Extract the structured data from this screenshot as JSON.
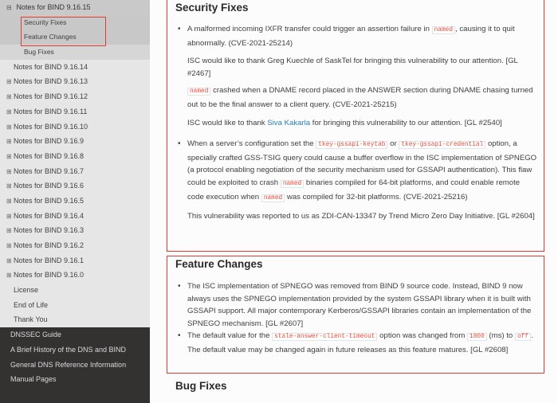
{
  "sidebar": {
    "current": {
      "toggle": "⊟",
      "label": "Notes for BIND 9.16.15"
    },
    "sub_items": [
      "Security Fixes",
      "Feature Changes",
      "Bug Fixes"
    ],
    "versions": [
      {
        "label": "Notes for BIND 9.16.14",
        "expandable": false
      },
      {
        "label": "Notes for BIND 9.16.13",
        "expandable": true
      },
      {
        "label": "Notes for BIND 9.16.12",
        "expandable": true
      },
      {
        "label": "Notes for BIND 9.16.11",
        "expandable": true
      },
      {
        "label": "Notes for BIND 9.16.10",
        "expandable": true
      },
      {
        "label": "Notes for BIND 9.16.9",
        "expandable": true
      },
      {
        "label": "Notes for BIND 9.16.8",
        "expandable": true
      },
      {
        "label": "Notes for BIND 9.16.7",
        "expandable": true
      },
      {
        "label": "Notes for BIND 9.16.6",
        "expandable": true
      },
      {
        "label": "Notes for BIND 9.16.5",
        "expandable": true
      },
      {
        "label": "Notes for BIND 9.16.4",
        "expandable": true
      },
      {
        "label": "Notes for BIND 9.16.3",
        "expandable": true
      },
      {
        "label": "Notes for BIND 9.16.2",
        "expandable": true
      },
      {
        "label": "Notes for BIND 9.16.1",
        "expandable": true
      },
      {
        "label": "Notes for BIND 9.16.0",
        "expandable": true
      }
    ],
    "plus_icon": "⊞",
    "extras": [
      "License",
      "End of Life",
      "Thank You"
    ],
    "top_items": [
      "DNSSEC Guide",
      "A Brief History of the DNS and BIND",
      "General DNS Reference Information",
      "Manual Pages"
    ]
  },
  "security": {
    "title": "Security Fixes",
    "item1_text": "A malformed incoming IXFR transfer could trigger an assertion failure in",
    "item1_code": "named",
    "item1_text2": ", causing it to quit abnormally. (CVE-2021-25214)",
    "item1_thanks": "ISC would like to thank Greg Kuechle of SaskTel for bringing this vulnerability to our attention. [GL #2467]",
    "item2_code": "named",
    "item2_text": "crashed when a DNAME record placed in the ANSWER section during DNAME chasing turned out to be the final answer to a client query. (CVE-2021-25215)",
    "item2_thanks_pre": "ISC would like to thank",
    "item2_link": "Siva Kakarla",
    "item2_thanks_post": "for bringing this vulnerability to our attention. [GL #2540]",
    "item3_a": "When a server’s configuration set the",
    "item3_code1": "tkey-gssapi-keytab",
    "item3_or": "or",
    "item3_code2": "tkey-gssapi-credential",
    "item3_b": "option, a specially crafted GSS-TSIG query could cause a buffer overflow in the ISC implementation of SPNEGO (a protocol enabling negotiation of the security mechanism used for GSSAPI authentication). This flaw could be exploited to crash",
    "item3_code3": "named",
    "item3_c": "binaries compiled for 64-bit platforms, and could enable remote code execution when",
    "item3_code4": "named",
    "item3_d": "was compiled for 32-bit platforms. (CVE-2021-25216)",
    "item3_report": "This vulnerability was reported to us as ZDI-CAN-13347 by Trend Micro Zero Day Initiative. [GL #2604]"
  },
  "feature": {
    "title": "Feature Changes",
    "item1": "The ISC implementation of SPNEGO was removed from BIND 9 source code. Instead, BIND 9 now always uses the SPNEGO implementation provided by the system GSSAPI library when it is built with GSSAPI support. All major contemporary Kerberos/GSSAPI libraries contain an implementation of the SPNEGO mechanism. [GL #2607]",
    "item2_a": "The default value for the",
    "item2_code1": "stale-answer-client-timeout",
    "item2_b": "option was changed from",
    "item2_code2": "1800",
    "item2_c": "(ms) to",
    "item2_code3": "off",
    "item2_d": ". The default value may be changed again in future releases as this feature matures. [GL #2608]"
  },
  "bugfixes": {
    "title": "Bug Fixes"
  },
  "colors": {
    "highlight_border": "#e53935",
    "sidebar_dark": "#343131",
    "link": "#2980b9",
    "code": "#e74c3c"
  }
}
